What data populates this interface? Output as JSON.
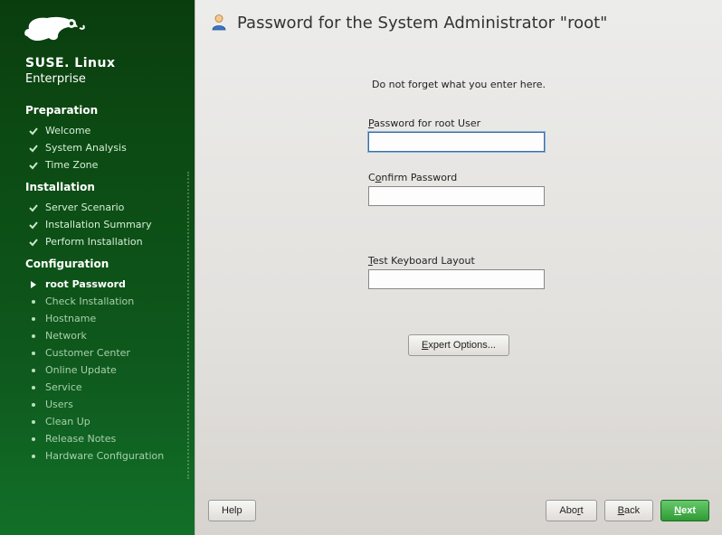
{
  "brand": {
    "name": "SUSE. Linux",
    "sub": "Enterprise"
  },
  "sections": {
    "preparation": {
      "header": "Preparation",
      "items": [
        {
          "label": "Welcome",
          "state": "done"
        },
        {
          "label": "System Analysis",
          "state": "done"
        },
        {
          "label": "Time Zone",
          "state": "done"
        }
      ]
    },
    "installation": {
      "header": "Installation",
      "items": [
        {
          "label": "Server Scenario",
          "state": "done"
        },
        {
          "label": "Installation Summary",
          "state": "done"
        },
        {
          "label": "Perform Installation",
          "state": "done"
        }
      ]
    },
    "configuration": {
      "header": "Configuration",
      "items": [
        {
          "label": "root Password",
          "state": "current"
        },
        {
          "label": "Check Installation",
          "state": "pending"
        },
        {
          "label": "Hostname",
          "state": "pending"
        },
        {
          "label": "Network",
          "state": "pending"
        },
        {
          "label": "Customer Center",
          "state": "pending"
        },
        {
          "label": "Online Update",
          "state": "pending"
        },
        {
          "label": "Service",
          "state": "pending"
        },
        {
          "label": "Users",
          "state": "pending"
        },
        {
          "label": "Clean Up",
          "state": "pending"
        },
        {
          "label": "Release Notes",
          "state": "pending"
        },
        {
          "label": "Hardware Configuration",
          "state": "pending"
        }
      ]
    }
  },
  "page": {
    "title": "Password for the System Administrator \"root\"",
    "hint": "Do not forget what you enter here.",
    "password_label": "Password for root User",
    "confirm_label": "Confirm Password",
    "test_label": "Test Keyboard Layout",
    "password_value": "",
    "confirm_value": "",
    "test_value": "",
    "expert_button": "Expert Options..."
  },
  "footer": {
    "help": "Help",
    "abort": "Abort",
    "back": "Back",
    "next": "Next"
  }
}
